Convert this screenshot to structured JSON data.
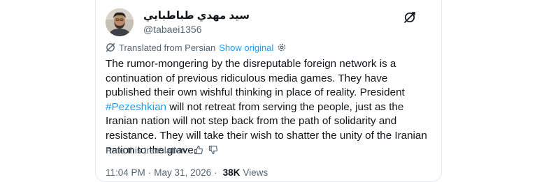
{
  "author": {
    "display_name": "سید مهدي طباطبايي",
    "handle": "@tabaei1356"
  },
  "translation": {
    "label": "Translated from Persian",
    "show_original": "Show original"
  },
  "tweet": {
    "text_before": "The rumor-mongering by the disreputable foreign network is a continuation of previous ridiculous media games. They have published their own wishful thinking in place of reality. President ",
    "hashtag": "#Pezeshkian",
    "text_after": " will not retreat from serving the people, just as the Iranian nation will not step back from the path of solidarity and resistance. They will take their wish to shatter the unity of the Iranian nation to the grave."
  },
  "rate": {
    "label": "Rate this translation:"
  },
  "meta": {
    "time": "11:04 PM",
    "date": "May 31, 2026",
    "separator": "·",
    "views_count": "38K",
    "views_label": "Views"
  },
  "colors": {
    "accent": "#1d9bf0",
    "text": "#0f1419",
    "muted": "#536471"
  },
  "icons": {
    "header_logo": "x-logo-icon",
    "translate": "translate-icon",
    "settings": "settings-gear-icon",
    "thumbs_up": "thumbs-up-icon",
    "thumbs_down": "thumbs-down-icon"
  }
}
